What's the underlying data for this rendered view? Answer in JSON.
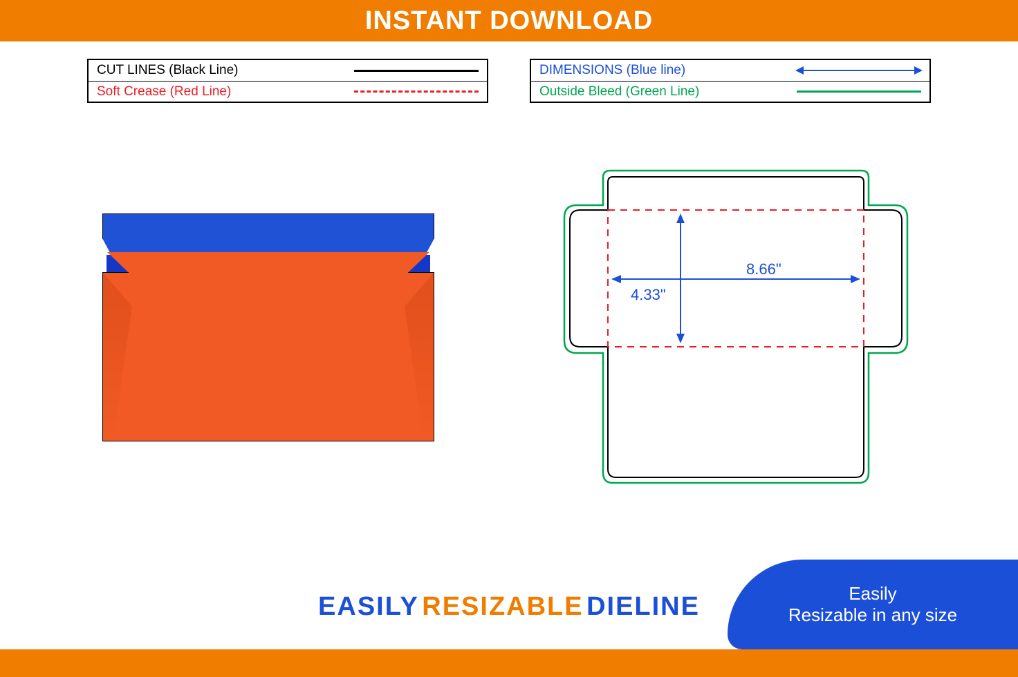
{
  "banner": {
    "title": "INSTANT DOWNLOAD"
  },
  "legend": {
    "left": [
      {
        "label": "CUT LINES (Black Line)",
        "color": "#000"
      },
      {
        "label": "Soft Crease (Red Line)",
        "color": "#ED1C24"
      }
    ],
    "right": [
      {
        "label": "DIMENSIONS (Blue line)",
        "color": "#1B4FD8"
      },
      {
        "label": "Outside Bleed (Green Line)",
        "color": "#00A651"
      }
    ]
  },
  "dimensions": {
    "height": "4.33\"",
    "width": "8.66\""
  },
  "footer": {
    "easily": "EASILY",
    "resizable": "RESIZABLE",
    "dieline": "DIELINE"
  },
  "swoosh": {
    "line1": "Easily",
    "line2": "Resizable in any size"
  },
  "colors": {
    "orange": "#F07C00",
    "blue": "#1B4FD8",
    "red": "#ED1C24",
    "green": "#00A651"
  }
}
